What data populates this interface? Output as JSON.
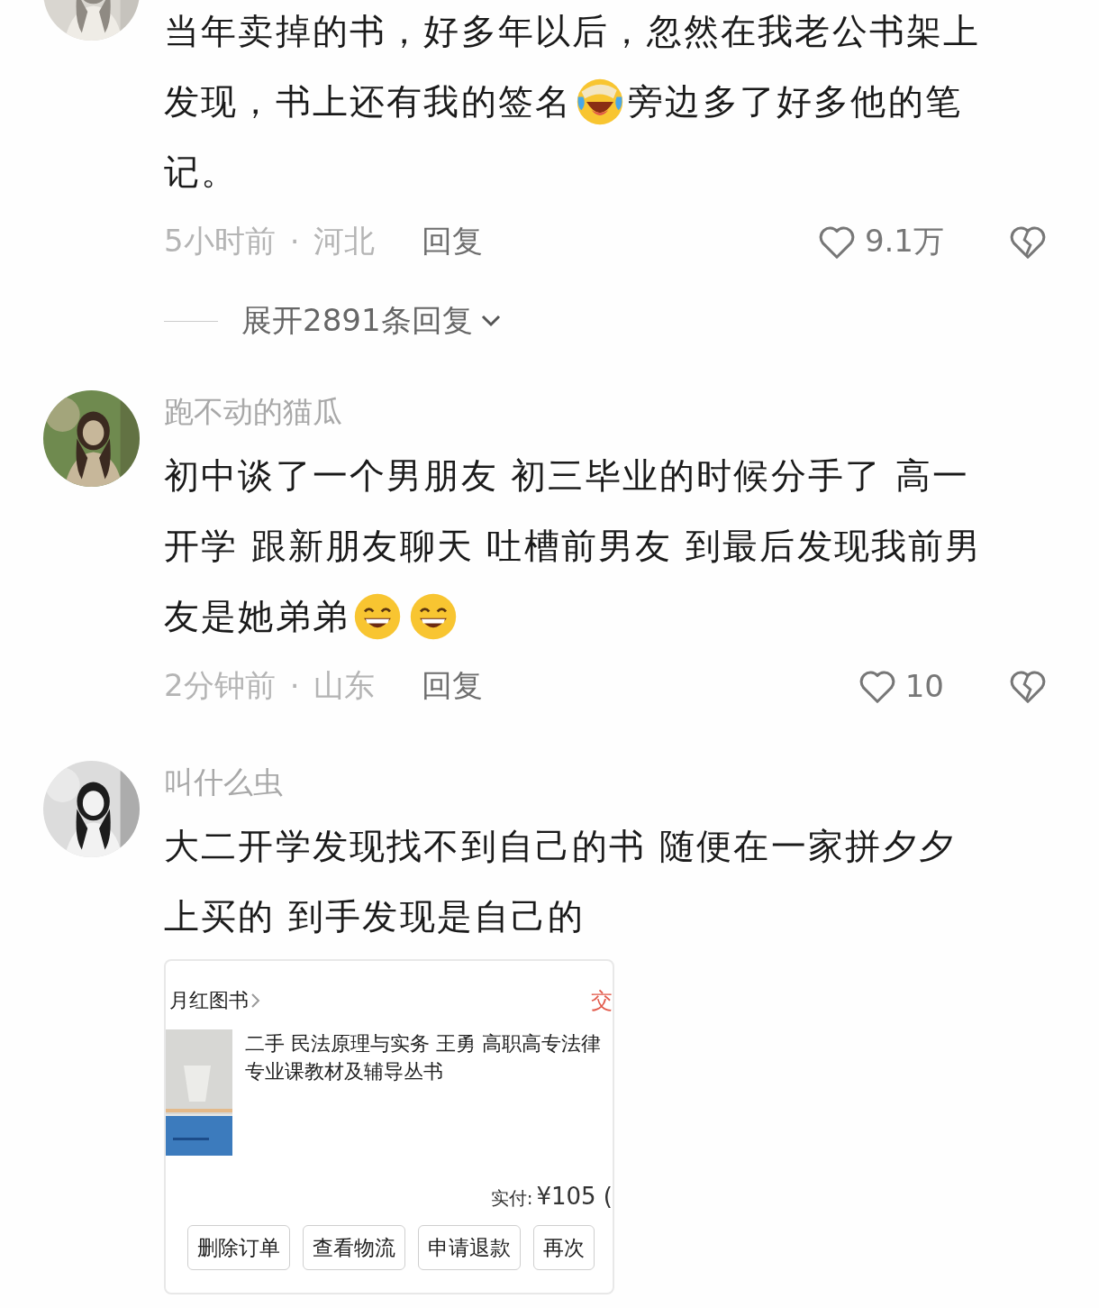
{
  "comments": [
    {
      "avatar": {
        "kind": "picture"
      },
      "lines": [
        [
          {
            "kind": "text",
            "text": "当年卖掉的书，好多年以后，忽然在我老公书架上"
          }
        ],
        [
          {
            "kind": "text",
            "text": "发现，书上还有我的签名"
          },
          {
            "kind": "laughcry"
          },
          {
            "kind": "text",
            "text": "旁边多了好多他的笔"
          }
        ],
        [
          {
            "kind": "text",
            "text": "记。"
          }
        ]
      ],
      "time": "5小时前",
      "separator": "·",
      "location": "河北",
      "reply": "回复",
      "likes": "9.1万",
      "expand": "展开2891条回复"
    },
    {
      "avatar": {
        "kind": "picture"
      },
      "username": "跑不动的猫瓜",
      "lines": [
        [
          {
            "kind": "text",
            "text": "初中谈了一个男朋友 初三毕业的时候分手了 高一"
          }
        ],
        [
          {
            "kind": "text",
            "text": "开学 跟新朋友聊天 吐槽前男友 到最后发现我前男"
          }
        ],
        [
          {
            "kind": "text",
            "text": "友是她弟弟"
          },
          {
            "kind": "grin"
          },
          {
            "kind": "grin"
          }
        ]
      ],
      "time": "2分钟前",
      "separator": "·",
      "location": "山东",
      "reply": "回复",
      "likes": "10"
    },
    {
      "avatar": {
        "kind": "picture"
      },
      "username": "叫什么虫",
      "lines": [
        [
          {
            "kind": "text",
            "text": "大二开学发现找不到自己的书 随便在一家拼夕夕"
          }
        ],
        [
          {
            "kind": "text",
            "text": "上买的 到手发现是自己的"
          }
        ]
      ],
      "attachment": {
        "shop": "月红图书",
        "status": "交",
        "title": "二手 民法原理与实务 王勇 高职高专法律专业课教材及辅导丛书",
        "paid_label": "实付:",
        "price": "¥105",
        "price_note": "(",
        "buttons": [
          "删除订单",
          "查看物流",
          "申请退款",
          "再次"
        ]
      }
    }
  ]
}
